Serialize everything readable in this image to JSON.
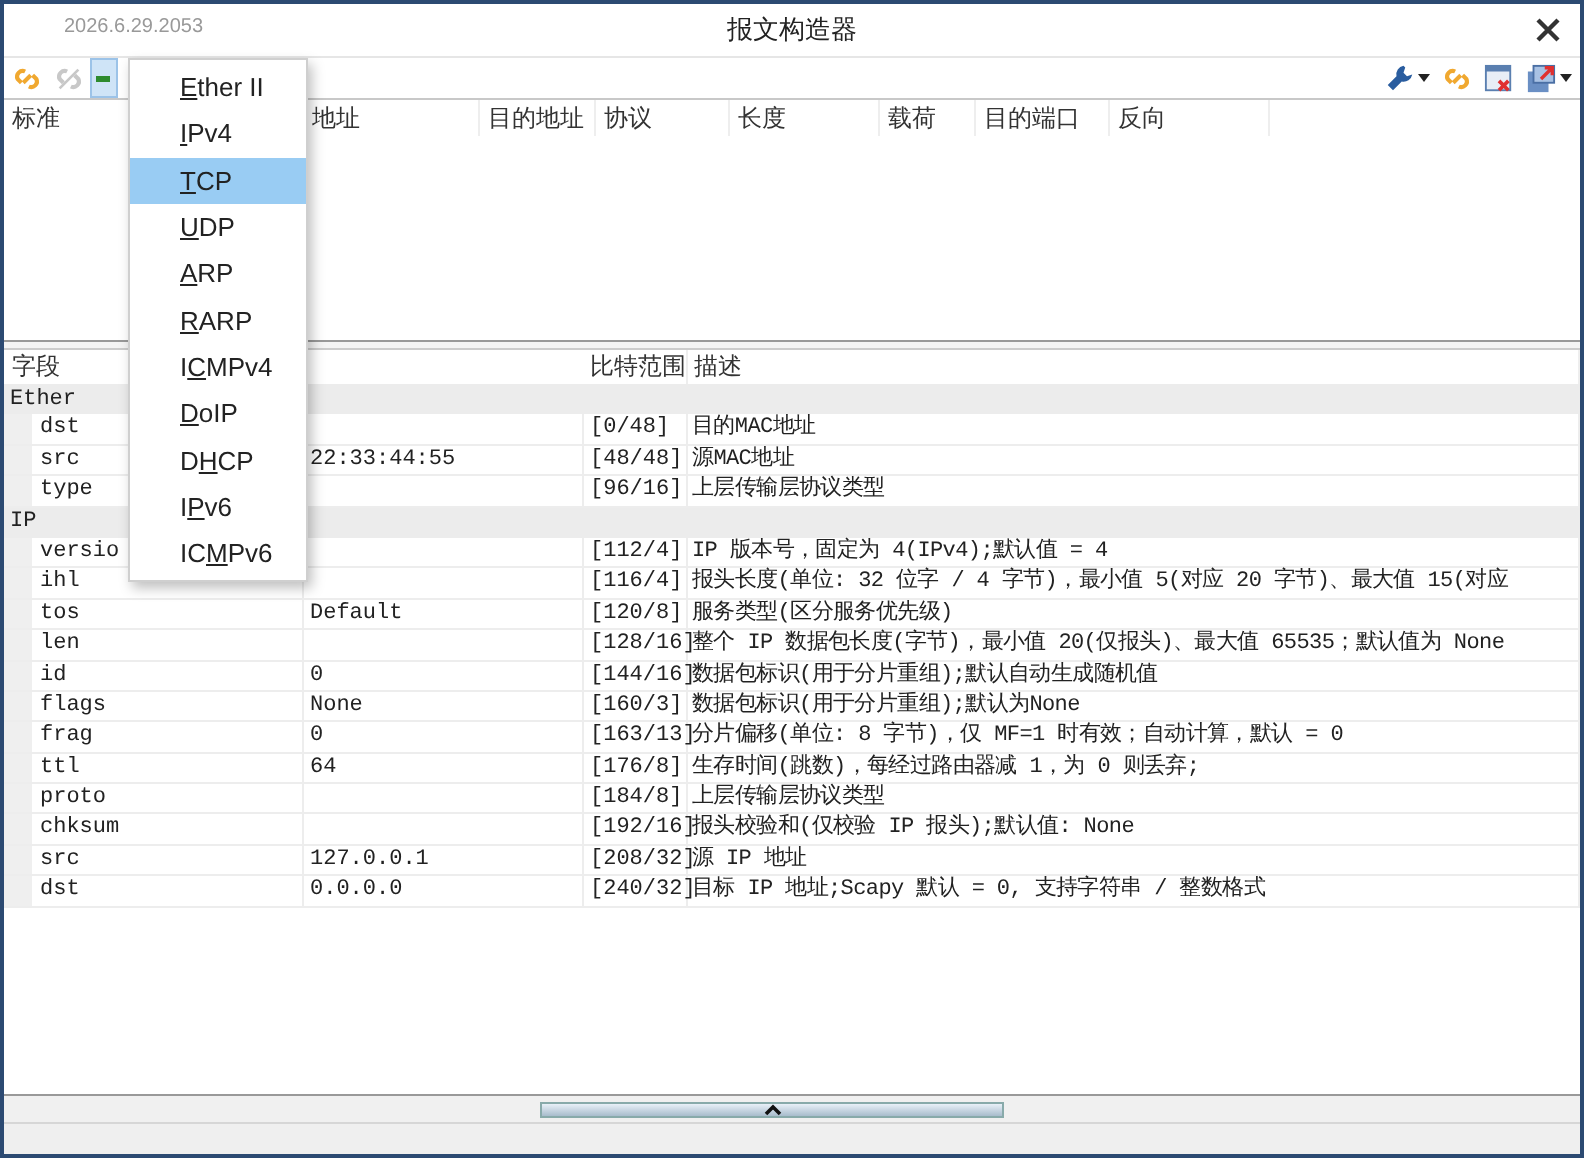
{
  "window": {
    "title": "报文构造器",
    "timestamp": "2026.6.29.2053"
  },
  "toolbar": {
    "left": [
      {
        "kind": "link",
        "disabled": false,
        "pressed": false
      },
      {
        "kind": "unlink",
        "disabled": true,
        "pressed": false
      },
      {
        "kind": "add",
        "disabled": false,
        "pressed": true
      }
    ],
    "right": [
      {
        "kind": "wrench",
        "dropdown": true
      },
      {
        "kind": "link",
        "dropdown": false
      },
      {
        "kind": "close-window",
        "dropdown": false
      },
      {
        "kind": "export",
        "dropdown": true
      }
    ]
  },
  "menu": {
    "items": [
      {
        "key": "E",
        "post": "ther II",
        "selected": false
      },
      {
        "key": "I",
        "post": "Pv4",
        "selected": false
      },
      {
        "key": "T",
        "post": "CP",
        "selected": true
      },
      {
        "key": "U",
        "post": "DP",
        "selected": false
      },
      {
        "key": "A",
        "post": "RP",
        "selected": false
      },
      {
        "key": "R",
        "post": "ARP",
        "selected": false
      },
      {
        "pre": "I",
        "key": "C",
        "post": "MPv4",
        "selected": false
      },
      {
        "key": "D",
        "post": "oIP",
        "selected": false
      },
      {
        "pre": "D",
        "key": "H",
        "post": "CP",
        "selected": false
      },
      {
        "pre": "I",
        "key": "P",
        "post": "v6",
        "selected": false
      },
      {
        "pre": "IC",
        "key": "M",
        "post": "Pv6",
        "selected": false
      }
    ]
  },
  "packet_table": {
    "columns": [
      "标准",
      "地址",
      "目的地址",
      "协议",
      "长度",
      "载荷",
      "目的端口",
      "反向"
    ]
  },
  "field_table": {
    "columns": [
      "字段",
      "比特范围",
      "描述"
    ],
    "groups": [
      {
        "name": "Ether",
        "fields": [
          {
            "name": "dst",
            "bits": "[0/48]",
            "description": "目的MAC地址"
          },
          {
            "name": "src",
            "value": "22:33:44:55",
            "bits": "[48/48]",
            "description": "源MAC地址"
          },
          {
            "name": "type",
            "bits": "[96/16]",
            "description": "上层传输层协议类型"
          }
        ]
      },
      {
        "name": "IP",
        "fields": [
          {
            "name": "versio",
            "bits": "[112/4]",
            "description": "IP 版本号，固定为 4(IPv4);默认值 = 4"
          },
          {
            "name": "ihl",
            "bits": "[116/4]",
            "description": "报头长度(单位: 32 位字 / 4 字节)，最小值 5(对应 20 字节)、最大值 15(对应"
          },
          {
            "name": "tos",
            "value": "Default",
            "bits": "[120/8]",
            "description": "服务类型(区分服务优先级)"
          },
          {
            "name": "len",
            "bits": "[128/16]",
            "description": "整个 IP 数据包长度(字节)，最小值 20(仅报头)、最大值 65535；默认值为 None"
          },
          {
            "name": "id",
            "value": "0",
            "bits": "[144/16]",
            "description": "数据包标识(用于分片重组);默认自动生成随机值"
          },
          {
            "name": "flags",
            "value": "None",
            "bits": "[160/3]",
            "description": "数据包标识(用于分片重组);默认为None"
          },
          {
            "name": "frag",
            "value": "0",
            "bits": "[163/13]",
            "description": "分片偏移(单位: 8 字节)，仅 MF=1 时有效；自动计算，默认 = 0"
          },
          {
            "name": "ttl",
            "value": "64",
            "bits": "[176/8]",
            "description": "生存时间(跳数)，每经过路由器减 1，为 0 则丢弃;"
          },
          {
            "name": "proto",
            "bits": "[184/8]",
            "description": "上层传输层协议类型"
          },
          {
            "name": "chksum",
            "bits": "[192/16]",
            "description": "报头校验和(仅校验 IP 报头);默认值: None"
          },
          {
            "name": "src",
            "value": "127.0.0.1",
            "bits": "[208/32]",
            "description": "源 IP 地址"
          },
          {
            "name": "dst",
            "value": "0.0.0.0",
            "bits": "[240/32]",
            "description": "目标 IP 地址;Scapy 默认 = 0, 支持字符串 / 整数格式"
          }
        ]
      }
    ]
  }
}
